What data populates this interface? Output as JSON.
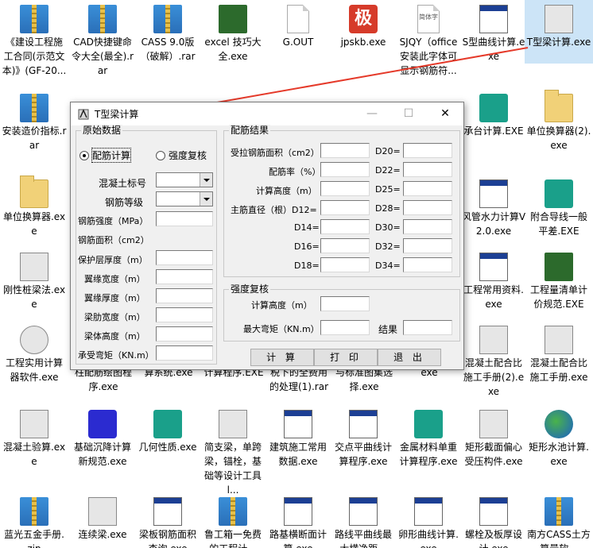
{
  "desktop": {
    "icons": [
      {
        "label": "《建设工程施工合同(示范文本)》(GF-20...",
        "kind": "zip"
      },
      {
        "label": "CAD快捷键命令大全(最全).rar",
        "kind": "zip"
      },
      {
        "label": "CASS 9.0版（破解）.rar",
        "kind": "zip"
      },
      {
        "label": "excel 技巧大全.exe",
        "kind": "exe"
      },
      {
        "label": "G.OUT",
        "kind": "doc"
      },
      {
        "label": "jpskb.exe",
        "kind": "red",
        "glyph": "极"
      },
      {
        "label": "SJQY（office安装此字体可显示钢筋符...",
        "kind": "doc",
        "glyph": "简体字"
      },
      {
        "label": "S型曲线计算.exe",
        "kind": "exe"
      },
      {
        "label": "T型梁计算.exe",
        "kind": "tool"
      },
      {
        "label": "安装造价指标.rar",
        "kind": "zip"
      },
      {
        "label": "承台计算.EXE",
        "kind": "exe"
      },
      {
        "label": "单位换算器(2).exe",
        "kind": "folder"
      },
      {
        "label": "单位换算器.exe",
        "kind": "folder"
      },
      {
        "label": "风管水力计算V2.0.exe",
        "kind": "exe"
      },
      {
        "label": "附合导线一般平差.EXE",
        "kind": "calc"
      },
      {
        "label": "刚性桩梁法.exe",
        "kind": "exe"
      },
      {
        "label": "工程常用资料.exe",
        "kind": "exe"
      },
      {
        "label": "工程量清单计价规范.EXE",
        "kind": "book"
      },
      {
        "label": "工程实用计算器软件.exe",
        "kind": "exe"
      },
      {
        "label": "混凝土配合比施工手册(2).exe",
        "kind": "exe"
      },
      {
        "label": "混凝土配合比施工手册.exe",
        "kind": "exe"
      },
      {
        "label": "柱配筋绘图程序.exe",
        "kind": "exe"
      },
      {
        "label": "算系统.exe",
        "kind": "exe"
      },
      {
        "label": "计算程序.EXE",
        "kind": "exe"
      },
      {
        "label": "税下的全费用的处理(1).rar",
        "kind": "zip"
      },
      {
        "label": "与标准图集选择.exe",
        "kind": "exe"
      },
      {
        "label": "exe",
        "kind": "exe"
      },
      {
        "label": "混凝土验算.exe",
        "kind": "exe"
      },
      {
        "label": "基础沉降计算新规范.exe",
        "kind": "exe"
      },
      {
        "label": "几何性质.exe",
        "kind": "exe"
      },
      {
        "label": "简支梁，单跨梁，锚栓，基础等设计工具l...",
        "kind": "exe"
      },
      {
        "label": "建筑施工常用数据.exe",
        "kind": "exe"
      },
      {
        "label": "交点平曲线计算程序.exe",
        "kind": "exe"
      },
      {
        "label": "金属材料单重计算程序.exe",
        "kind": "calc"
      },
      {
        "label": "矩形截面偏心受压构件.exe",
        "kind": "exe"
      },
      {
        "label": "矩形水池计算.exe",
        "kind": "globe"
      },
      {
        "label": "蓝光五金手册.zip",
        "kind": "zip"
      },
      {
        "label": "连续梁.exe",
        "kind": "exe"
      },
      {
        "label": "梁板钢筋面积查询.exe",
        "kind": "exe"
      },
      {
        "label": "鲁工箱一免费的工程计...",
        "kind": "zip"
      },
      {
        "label": "路基横断面计算.exe",
        "kind": "exe"
      },
      {
        "label": "路线平曲线最大横净距...",
        "kind": "exe"
      },
      {
        "label": "卵形曲线计算.exe",
        "kind": "exe"
      },
      {
        "label": "螺栓及板厚设计.exe",
        "kind": "exe"
      },
      {
        "label": "南方CASS土方算量软...",
        "kind": "zip"
      }
    ]
  },
  "window": {
    "title": "T型梁计算",
    "min": "—",
    "max": "☐",
    "close": "✕",
    "left_group": {
      "title": "原始数据",
      "radio1": "配筋计算",
      "radio2": "强度复核",
      "labels": [
        "混凝土标号",
        "钢筋等级",
        "钢筋强度（MPa）",
        "钢筋面积（cm2）",
        "保护层厚度（m）",
        "翼缘宽度（m）",
        "翼缘厚度（m）",
        "梁肋宽度（m）",
        "梁体高度（m）",
        "承受弯矩（KN.m）"
      ]
    },
    "right_group": {
      "title": "配筋结果",
      "labels": [
        "受拉钢筋面积（cm2）",
        "配筋率（%）",
        "计算高度（m）",
        "主筋直径（根）D12=",
        "D14=",
        "D16=",
        "D18="
      ],
      "dlabels": [
        "D20=",
        "D22=",
        "D25=",
        "D28=",
        "D30=",
        "D32=",
        "D34="
      ]
    },
    "check_group": {
      "title": "强度复核",
      "calc_height": "计算高度（m）",
      "max_moment": "最大弯矩（KN.m）",
      "result": "结果"
    },
    "buttons": {
      "calc": "计 算",
      "print": "打 印",
      "exit": "退 出"
    }
  }
}
